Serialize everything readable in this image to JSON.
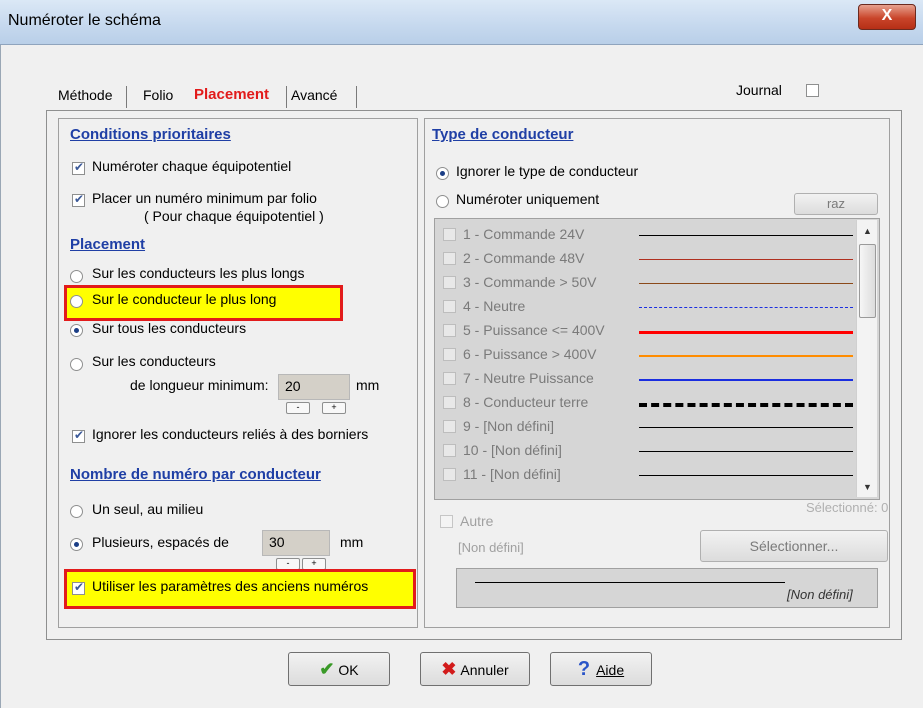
{
  "window": {
    "title": "Numéroter le schéma",
    "close": "X"
  },
  "tabs": [
    "Méthode",
    "Folio",
    "Placement",
    "Avancé"
  ],
  "journal": {
    "label": "Journal",
    "checked": false
  },
  "left": {
    "conditions_title": "Conditions prioritaires",
    "cond1": "Numéroter chaque équipotentiel",
    "cond2": "Placer un numéro minimum par folio",
    "cond2_sub": "( Pour chaque équipotentiel )",
    "placement_title": "Placement",
    "opt1": "Sur les conducteurs les plus longs",
    "opt2": "Sur le conducteur le plus long",
    "opt3": "Sur tous les conducteurs",
    "opt4": "Sur les conducteurs",
    "min_label": "de longueur minimum:",
    "min_value": "20",
    "min_unit": "mm",
    "ignore_label": "Ignorer les conducteurs reliés à des borniers",
    "nombre_title": "Nombre de numéro par conducteur",
    "single": "Un seul, au milieu",
    "multiple": "Plusieurs, espacés de",
    "space_value": "30",
    "space_unit": "mm",
    "use_old": "Utiliser les paramètres des anciens numéros",
    "spin_minus": "-",
    "spin_plus": "+"
  },
  "right": {
    "title": "Type de conducteur",
    "ignore": "Ignorer le type de conducteur",
    "only": "Numéroter uniquement",
    "raz": "raz",
    "rows": [
      {
        "label": "1 - Commande 24V",
        "color": "#000000",
        "style": "solid",
        "w": 1
      },
      {
        "label": "2 - Commande 48V",
        "color": "#b03020",
        "style": "solid",
        "w": 1
      },
      {
        "label": "3 - Commande > 50V",
        "color": "#8b4a1a",
        "style": "solid",
        "w": 1
      },
      {
        "label": "4 - Neutre",
        "color": "#1a2ee0",
        "style": "dashed",
        "w": 1
      },
      {
        "label": "5 - Puissance <= 400V",
        "color": "#ff0000",
        "style": "solid",
        "w": 3
      },
      {
        "label": "6 - Puissance > 400V",
        "color": "#ff8c00",
        "style": "solid",
        "w": 2
      },
      {
        "label": "7 - Neutre Puissance",
        "color": "#1a2ee0",
        "style": "solid",
        "w": 2
      },
      {
        "label": "8 - Conducteur terre",
        "color": "#000000",
        "style": "dashed",
        "w": 4
      },
      {
        "label": "9 - [Non défini]",
        "color": "#000000",
        "style": "solid",
        "w": 1
      },
      {
        "label": "10 - [Non défini]",
        "color": "#000000",
        "style": "solid",
        "w": 1
      },
      {
        "label": "11 - [Non défini]",
        "color": "#000000",
        "style": "solid",
        "w": 1
      }
    ],
    "selected": "Sélectionné: 0",
    "autre": "Autre",
    "non_defini": "[Non défini]",
    "select_btn": "Sélectionner...",
    "preview_label": "[Non défini]"
  },
  "buttons": {
    "ok": "OK",
    "cancel": "Annuler",
    "help": "Aide"
  },
  "colors": {
    "accent_red": "#e21b1b",
    "highlight": "#ffff00",
    "heading": "#1f3fa5"
  }
}
